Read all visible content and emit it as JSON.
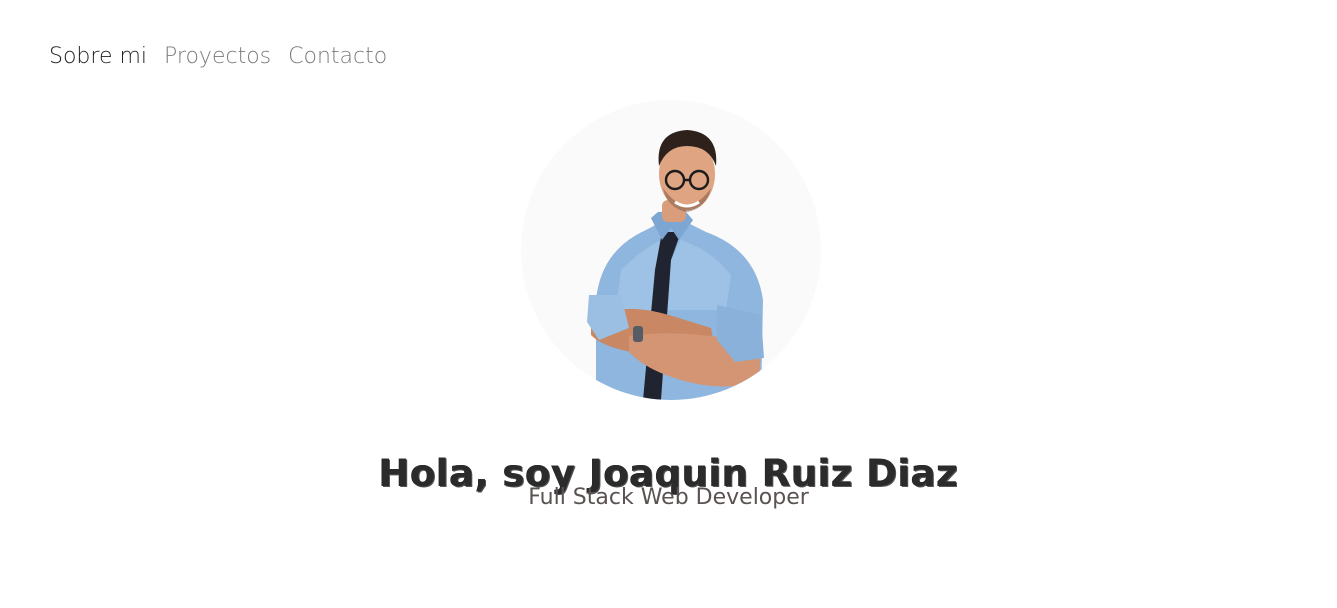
{
  "nav": {
    "items": [
      {
        "label": "Sobre mi",
        "active": true
      },
      {
        "label": "Proyectos",
        "active": false
      },
      {
        "label": "Contacto",
        "active": false
      }
    ]
  },
  "hero": {
    "title": "Hola, soy Joaquin Ruiz Diaz",
    "subtitle": "Full Stack Web Developer"
  },
  "colors": {
    "nav_active": "#212121",
    "nav_inactive": "#7b7b7b",
    "title": "#2b2b2b",
    "subtitle": "#5b5252",
    "avatar_bg": "#fafafa"
  }
}
